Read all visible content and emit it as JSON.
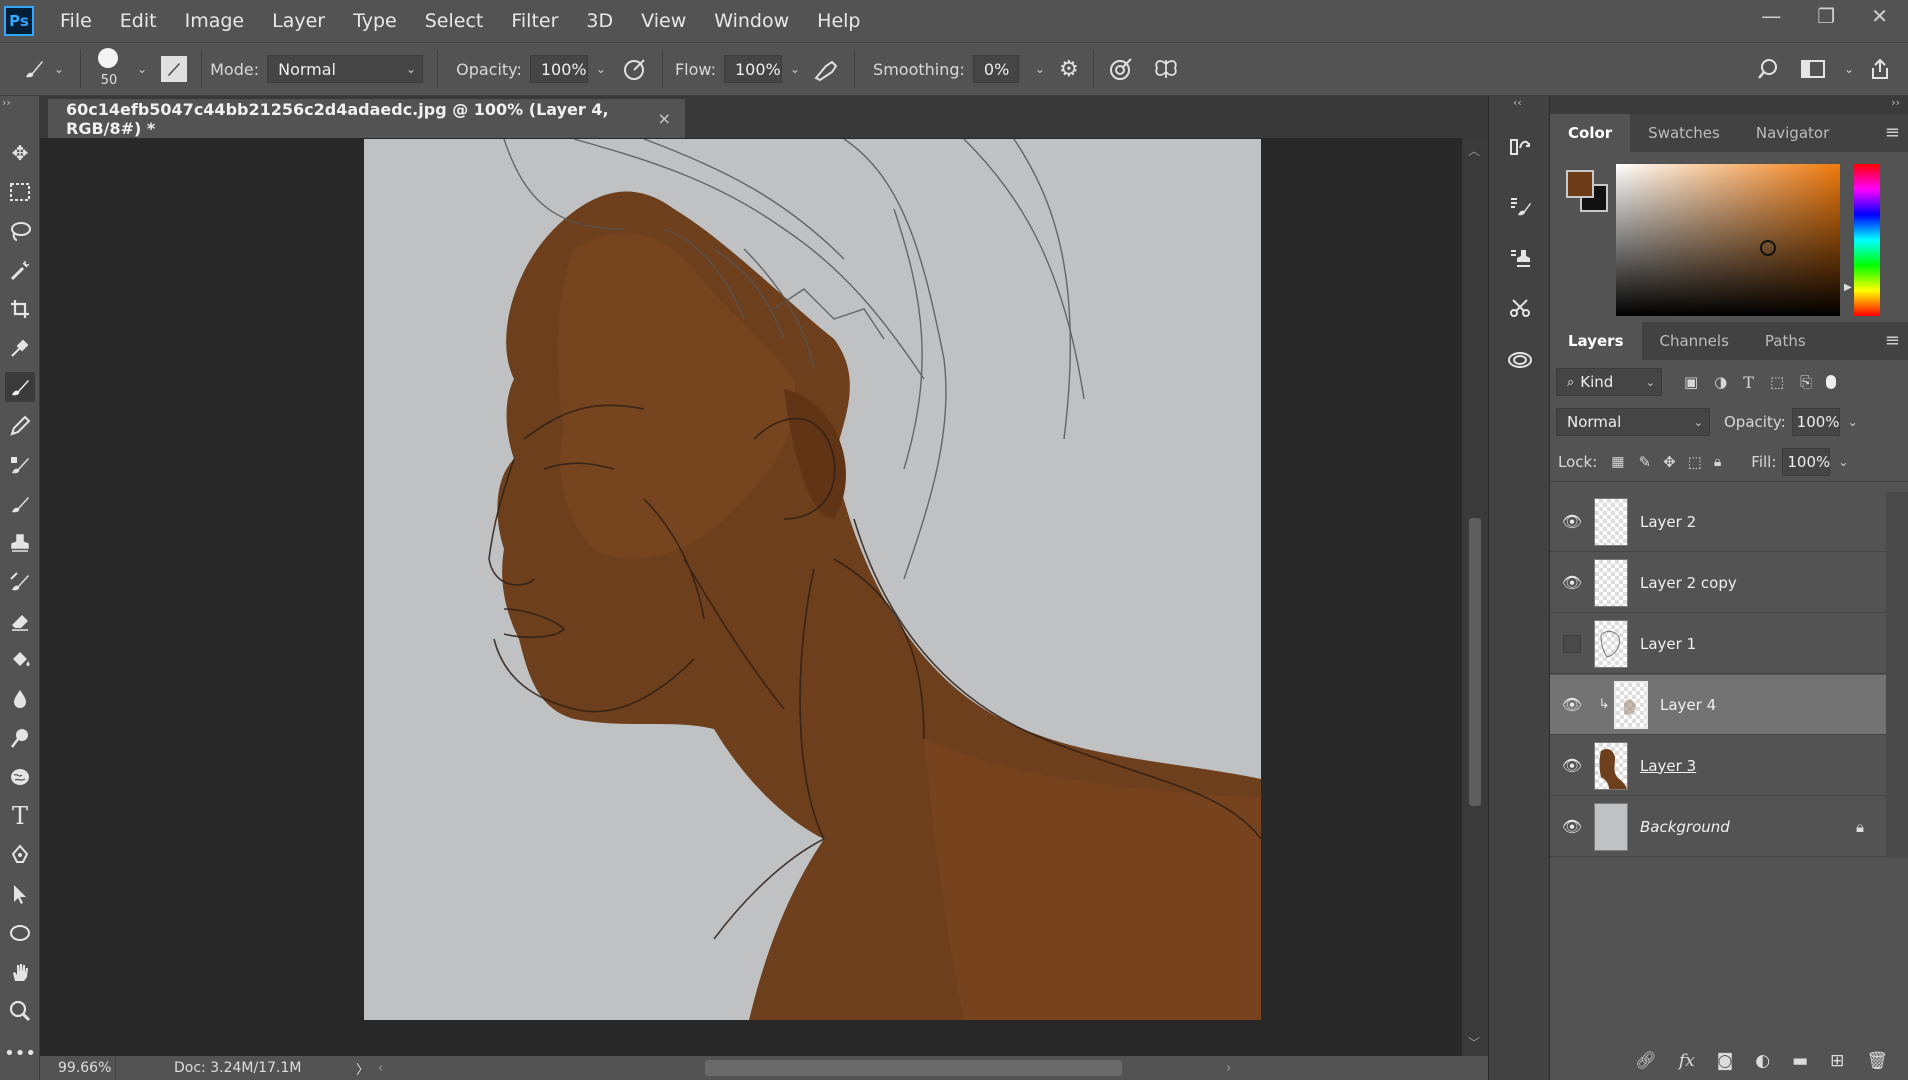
{
  "app": {
    "logo": "Ps"
  },
  "menu": [
    "File",
    "Edit",
    "Image",
    "Layer",
    "Type",
    "Select",
    "Filter",
    "3D",
    "View",
    "Window",
    "Help"
  ],
  "window_controls": {
    "minimize": "—",
    "restore": "❐",
    "close": "✕"
  },
  "options": {
    "brush_size": "50",
    "mode_label": "Mode:",
    "mode_value": "Normal",
    "opacity_label": "Opacity:",
    "opacity_value": "100%",
    "flow_label": "Flow:",
    "flow_value": "100%",
    "smoothing_label": "Smoothing:",
    "smoothing_value": "0%"
  },
  "document": {
    "tab_title": "60c14efb5047c44bb21256c2d4adaedc.jpg @ 100% (Layer 4, RGB/8#) *",
    "close": "×"
  },
  "status": {
    "zoom": "99.66%",
    "doc_info": "Doc: 3.24M/17.1M",
    "arrow": "〉"
  },
  "color_panel": {
    "tabs": [
      "Color",
      "Swatches",
      "Navigator"
    ],
    "active_tab": "Color",
    "foreground": "#6d3b17",
    "background": "#111111",
    "picker_hue": "#f07a0c"
  },
  "layers_panel": {
    "tabs": [
      "Layers",
      "Channels",
      "Paths"
    ],
    "filter_value": "Kind",
    "blend_value": "Normal",
    "opacity_label": "Opacity:",
    "opacity_value": "100%",
    "lock_label": "Lock:",
    "fill_label": "Fill:",
    "fill_value": "100%",
    "layers": [
      {
        "name": "Layer 2",
        "visible": true
      },
      {
        "name": "Layer 2 copy",
        "visible": true
      },
      {
        "name": "Layer 1",
        "visible": false
      },
      {
        "name": "Layer 4",
        "visible": true,
        "selected": true,
        "clipped": true
      },
      {
        "name": "Layer 3",
        "visible": true
      },
      {
        "name": "Background",
        "visible": true,
        "locked": true
      }
    ]
  },
  "colors": {
    "skin": "#6b3e1d",
    "canvas_bg": "#c0c1c3",
    "accent": "#31a8ff"
  }
}
